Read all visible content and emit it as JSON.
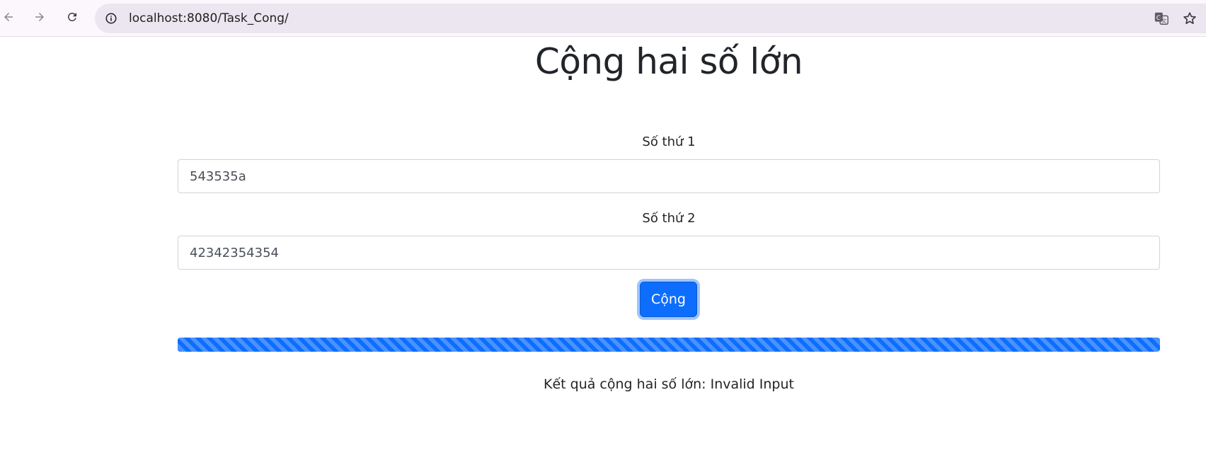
{
  "browser": {
    "url": "localhost:8080/Task_Cong/",
    "icons": {
      "back": "arrow-left-icon",
      "forward": "arrow-right-icon",
      "reload": "reload-icon",
      "site_info": "info-circle-icon",
      "translate": "translate-icon",
      "bookmark": "star-icon"
    }
  },
  "page": {
    "title": "Cộng hai số lớn",
    "field1": {
      "label": "Số thứ 1",
      "value": "543535a"
    },
    "field2": {
      "label": "Số thứ 2",
      "value": "42342354354"
    },
    "button_label": "Cộng",
    "progress_fraction": 1.0,
    "result_text": "Kết quả cộng hai số lớn: Invalid Input"
  },
  "colors": {
    "primary": "#0d6efd",
    "text": "#212529"
  }
}
